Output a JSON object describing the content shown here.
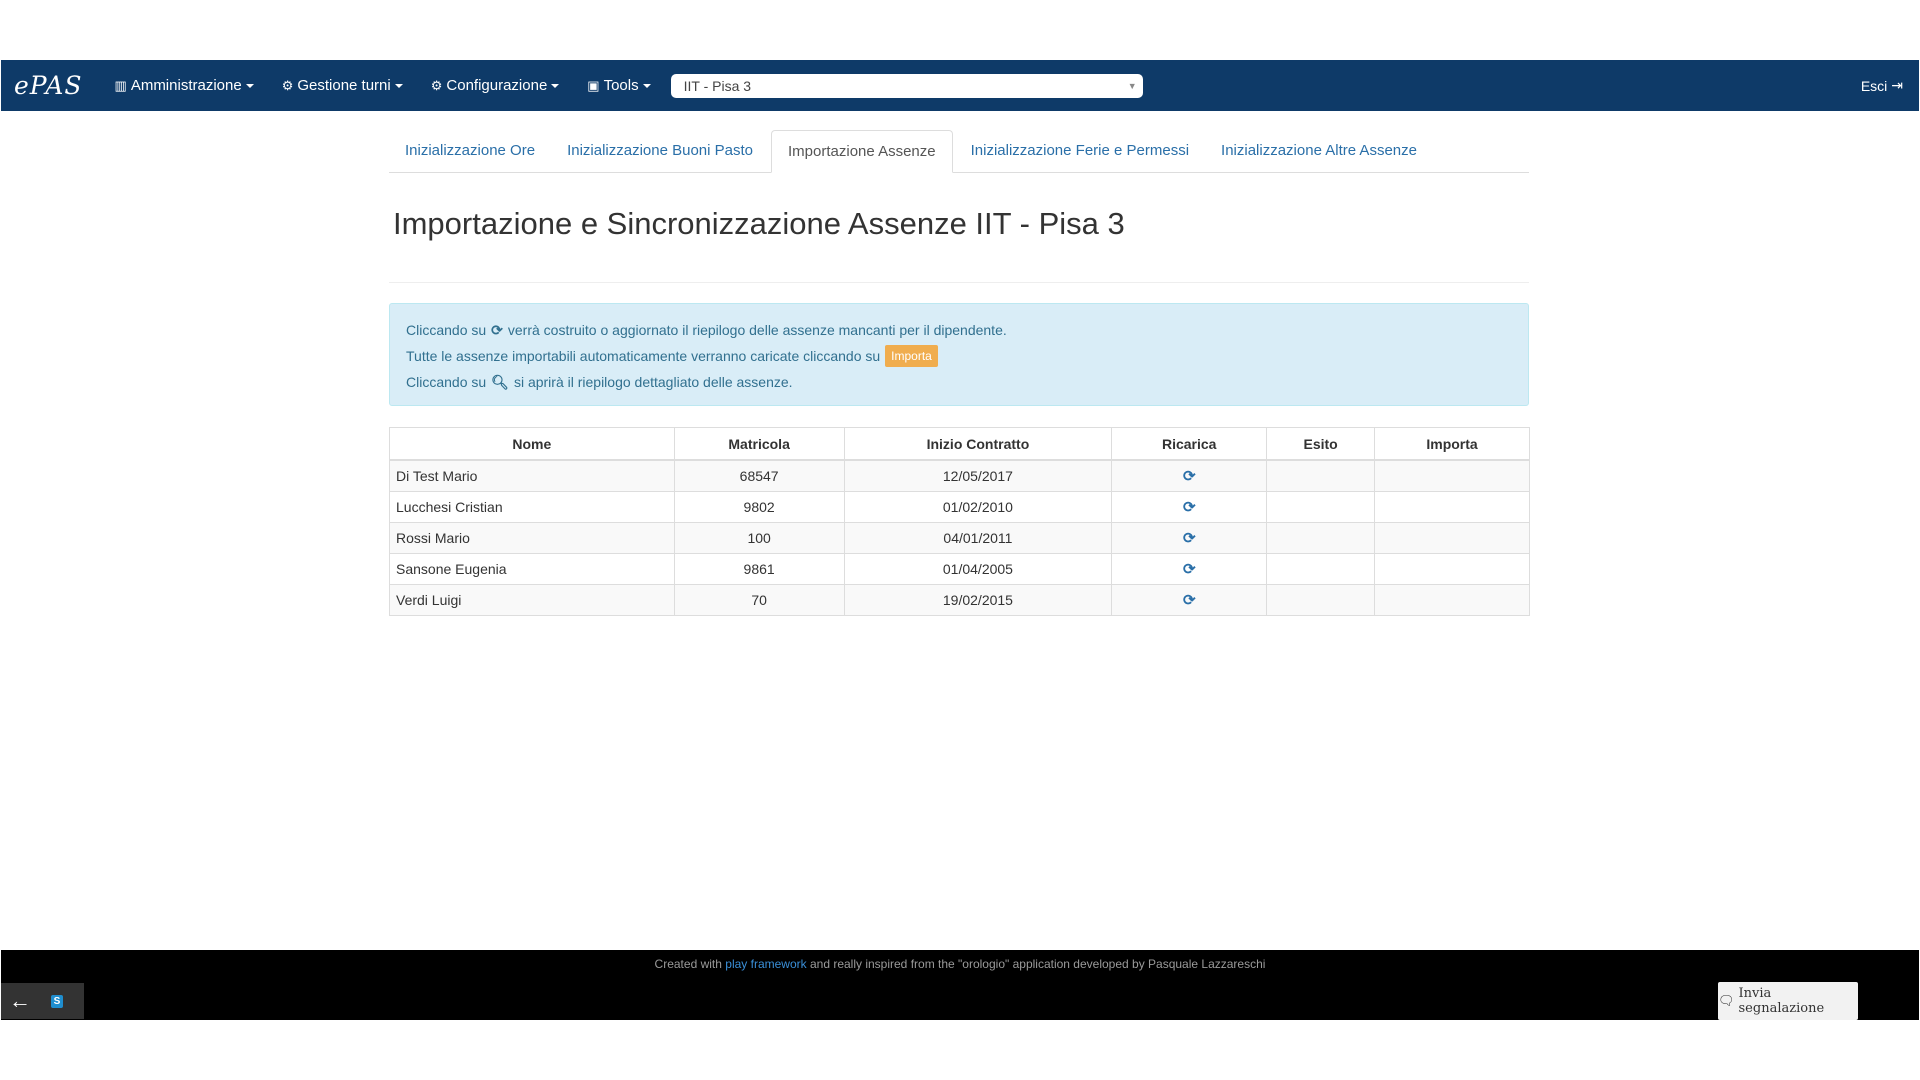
{
  "navbar": {
    "brand": "ePAS",
    "menus": [
      {
        "icon": "bar-chart-icon",
        "glyph": "▥",
        "label": "Amministrazione"
      },
      {
        "icon": "gear-icon",
        "glyph": "⚙",
        "label": "Gestione turni"
      },
      {
        "icon": "gear-icon",
        "glyph": "⚙",
        "label": "Configurazione"
      },
      {
        "icon": "toolbox-icon",
        "glyph": "▣",
        "label": "Tools"
      }
    ],
    "office_select": "IIT - Pisa 3",
    "logout_label": "Esci"
  },
  "tabs": [
    {
      "label": "Inizializzazione Ore",
      "active": false
    },
    {
      "label": "Inizializzazione Buoni Pasto",
      "active": false
    },
    {
      "label": "Importazione Assenze",
      "active": true
    },
    {
      "label": "Inizializzazione Ferie e Permessi",
      "active": false
    },
    {
      "label": "Inizializzazione Altre Assenze",
      "active": false
    }
  ],
  "page_title": "Importazione e Sincronizzazione Assenze IIT - Pisa 3",
  "info": {
    "line1_a": "Cliccando su",
    "line1_b": "verrà costruito o aggiornato il riepilogo delle assenze mancanti per il dipendente.",
    "line2_a": "Tutte le assenze importabili automaticamente verranno caricate cliccando su",
    "line2_badge": "Importa",
    "line3_a": "Cliccando su",
    "line3_b": "si aprirà il riepilogo dettagliato delle assenze."
  },
  "table": {
    "headers": [
      "Nome",
      "Matricola",
      "Inizio Contratto",
      "Ricarica",
      "Esito",
      "Importa"
    ],
    "rows": [
      {
        "nome": "Di Test Mario",
        "matricola": "68547",
        "inizio": "12/05/2017",
        "esito": "",
        "importa": ""
      },
      {
        "nome": "Lucchesi Cristian",
        "matricola": "9802",
        "inizio": "01/02/2010",
        "esito": "",
        "importa": ""
      },
      {
        "nome": "Rossi Mario",
        "matricola": "100",
        "inizio": "04/01/2011",
        "esito": "",
        "importa": ""
      },
      {
        "nome": "Sansone Eugenia",
        "matricola": "9861",
        "inizio": "01/04/2005",
        "esito": "",
        "importa": ""
      },
      {
        "nome": "Verdi Luigi",
        "matricola": "70",
        "inizio": "19/02/2015",
        "esito": "",
        "importa": ""
      }
    ]
  },
  "footer": {
    "text_a": "Created with",
    "link": "play framework",
    "text_b": "and really inspired from the \"orologio\" application developed by Pasquale Lazzareschi",
    "report_button": "Invia segnalazione"
  },
  "colors": {
    "navbar": "#0e3a68",
    "link": "#2a6fa8",
    "info_bg": "#d9edf7",
    "badge": "#f0ad4e"
  }
}
